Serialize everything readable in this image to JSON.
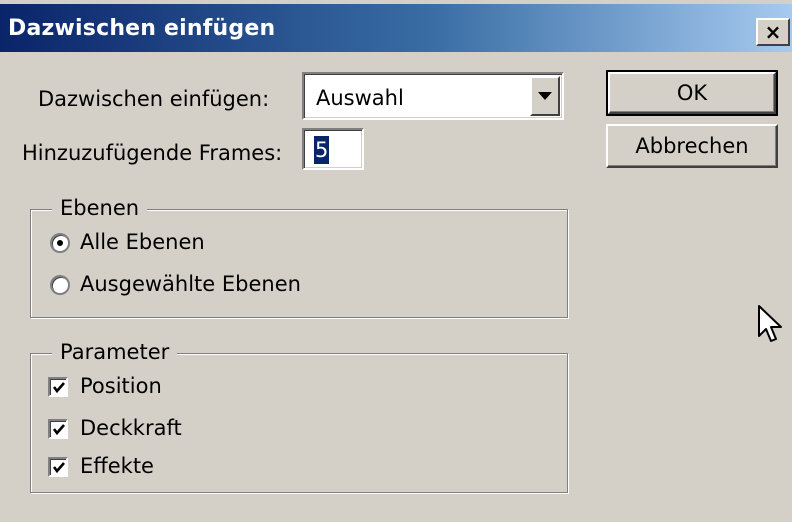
{
  "window": {
    "title": "Dazwischen einfügen",
    "close_glyph": "×"
  },
  "form": {
    "interpolate_label": "Dazwischen einfügen:",
    "interpolate_value": "Auswahl",
    "frames_label": "Hinzuzufügende Frames:",
    "frames_value": "5"
  },
  "buttons": {
    "ok_label": "OK",
    "cancel_label": "Abbrechen"
  },
  "layers_group": {
    "title": "Ebenen",
    "options": [
      {
        "label": "Alle Ebenen",
        "selected": true
      },
      {
        "label": "Ausgewählte Ebenen",
        "selected": false
      }
    ]
  },
  "parameter_group": {
    "title": "Parameter",
    "options": [
      {
        "label": "Position",
        "checked": true
      },
      {
        "label": "Deckkraft",
        "checked": true
      },
      {
        "label": "Effekte",
        "checked": true
      }
    ]
  },
  "icons": {
    "close": "close-icon",
    "dropdown": "chevron-down-icon",
    "check": "check-icon",
    "cursor": "mouse-pointer-icon"
  }
}
